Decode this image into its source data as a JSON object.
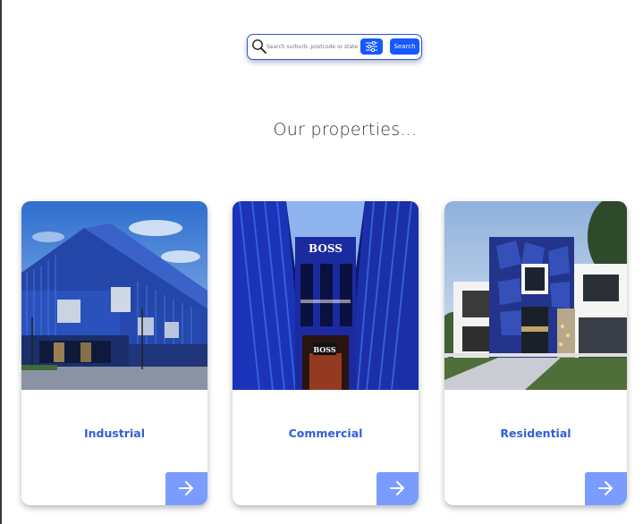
{
  "search": {
    "placeholder": "Search surburb ,postcode or state",
    "button_label": "Search"
  },
  "page": {
    "title": "Our properties..."
  },
  "properties": [
    {
      "label": "Industrial"
    },
    {
      "label": "Commercial"
    },
    {
      "label": "Residential"
    }
  ],
  "store_signs": {
    "upper": "BOSS",
    "lower": "BOSS"
  },
  "icons": {
    "search": "search-icon",
    "filter": "sliders-icon",
    "arrow": "arrow-right-icon"
  },
  "colors": {
    "accent": "#1559ff",
    "card_label": "#2f5fd8",
    "arrow_button": "#7a9cff",
    "title_text": "#333333"
  }
}
